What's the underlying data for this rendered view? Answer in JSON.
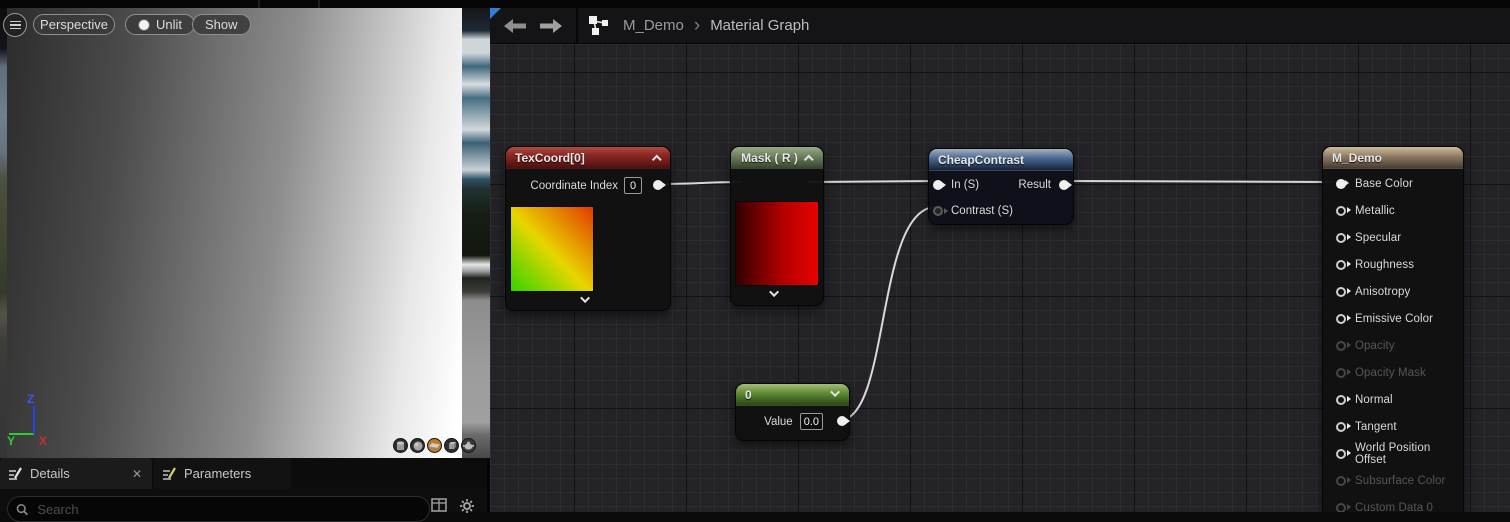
{
  "viewport": {
    "toolbar": {
      "perspective": "Perspective",
      "unlit": "Unlit",
      "show": "Show"
    },
    "axis": {
      "x": "X",
      "y": "Y",
      "z": "Z"
    }
  },
  "graph": {
    "breadcrumb": {
      "asset": "M_Demo",
      "separator": "›",
      "page": "Material Graph"
    },
    "nodes": {
      "texcoord": {
        "title": "TexCoord[0]",
        "field_label": "Coordinate Index",
        "field_value": "0"
      },
      "mask": {
        "title": "Mask ( R )"
      },
      "cheap_contrast": {
        "title": "CheapContrast",
        "input1": "In (S)",
        "input2": "Contrast (S)",
        "output": "Result"
      },
      "scalar": {
        "title": "0",
        "field_label": "Value",
        "field_value": "0.0"
      },
      "material_result": {
        "title": "M_Demo",
        "pins": [
          {
            "label": "Base Color"
          },
          {
            "label": "Metallic"
          },
          {
            "label": "Specular"
          },
          {
            "label": "Roughness"
          },
          {
            "label": "Anisotropy"
          },
          {
            "label": "Emissive Color"
          },
          {
            "label": "Opacity"
          },
          {
            "label": "Opacity Mask"
          },
          {
            "label": "Normal"
          },
          {
            "label": "Tangent"
          },
          {
            "label": "World Position Offset"
          },
          {
            "label": "Subsurface Color"
          },
          {
            "label": "Custom Data 0"
          }
        ]
      }
    }
  },
  "details_panel": {
    "tab_details": "Details",
    "tab_parameters": "Parameters",
    "close": "✕",
    "search_placeholder": "Search"
  },
  "colors": {
    "focus_blue": "#2f7fd8",
    "header_texcoord": "#8c2824",
    "header_mask": "#6f8460",
    "header_contrast": "#4a678f",
    "header_scalar": "#5f8a33",
    "header_result": "#8d7a62",
    "selected_shape": "#c27b21",
    "wire": "#d8d8d8"
  }
}
